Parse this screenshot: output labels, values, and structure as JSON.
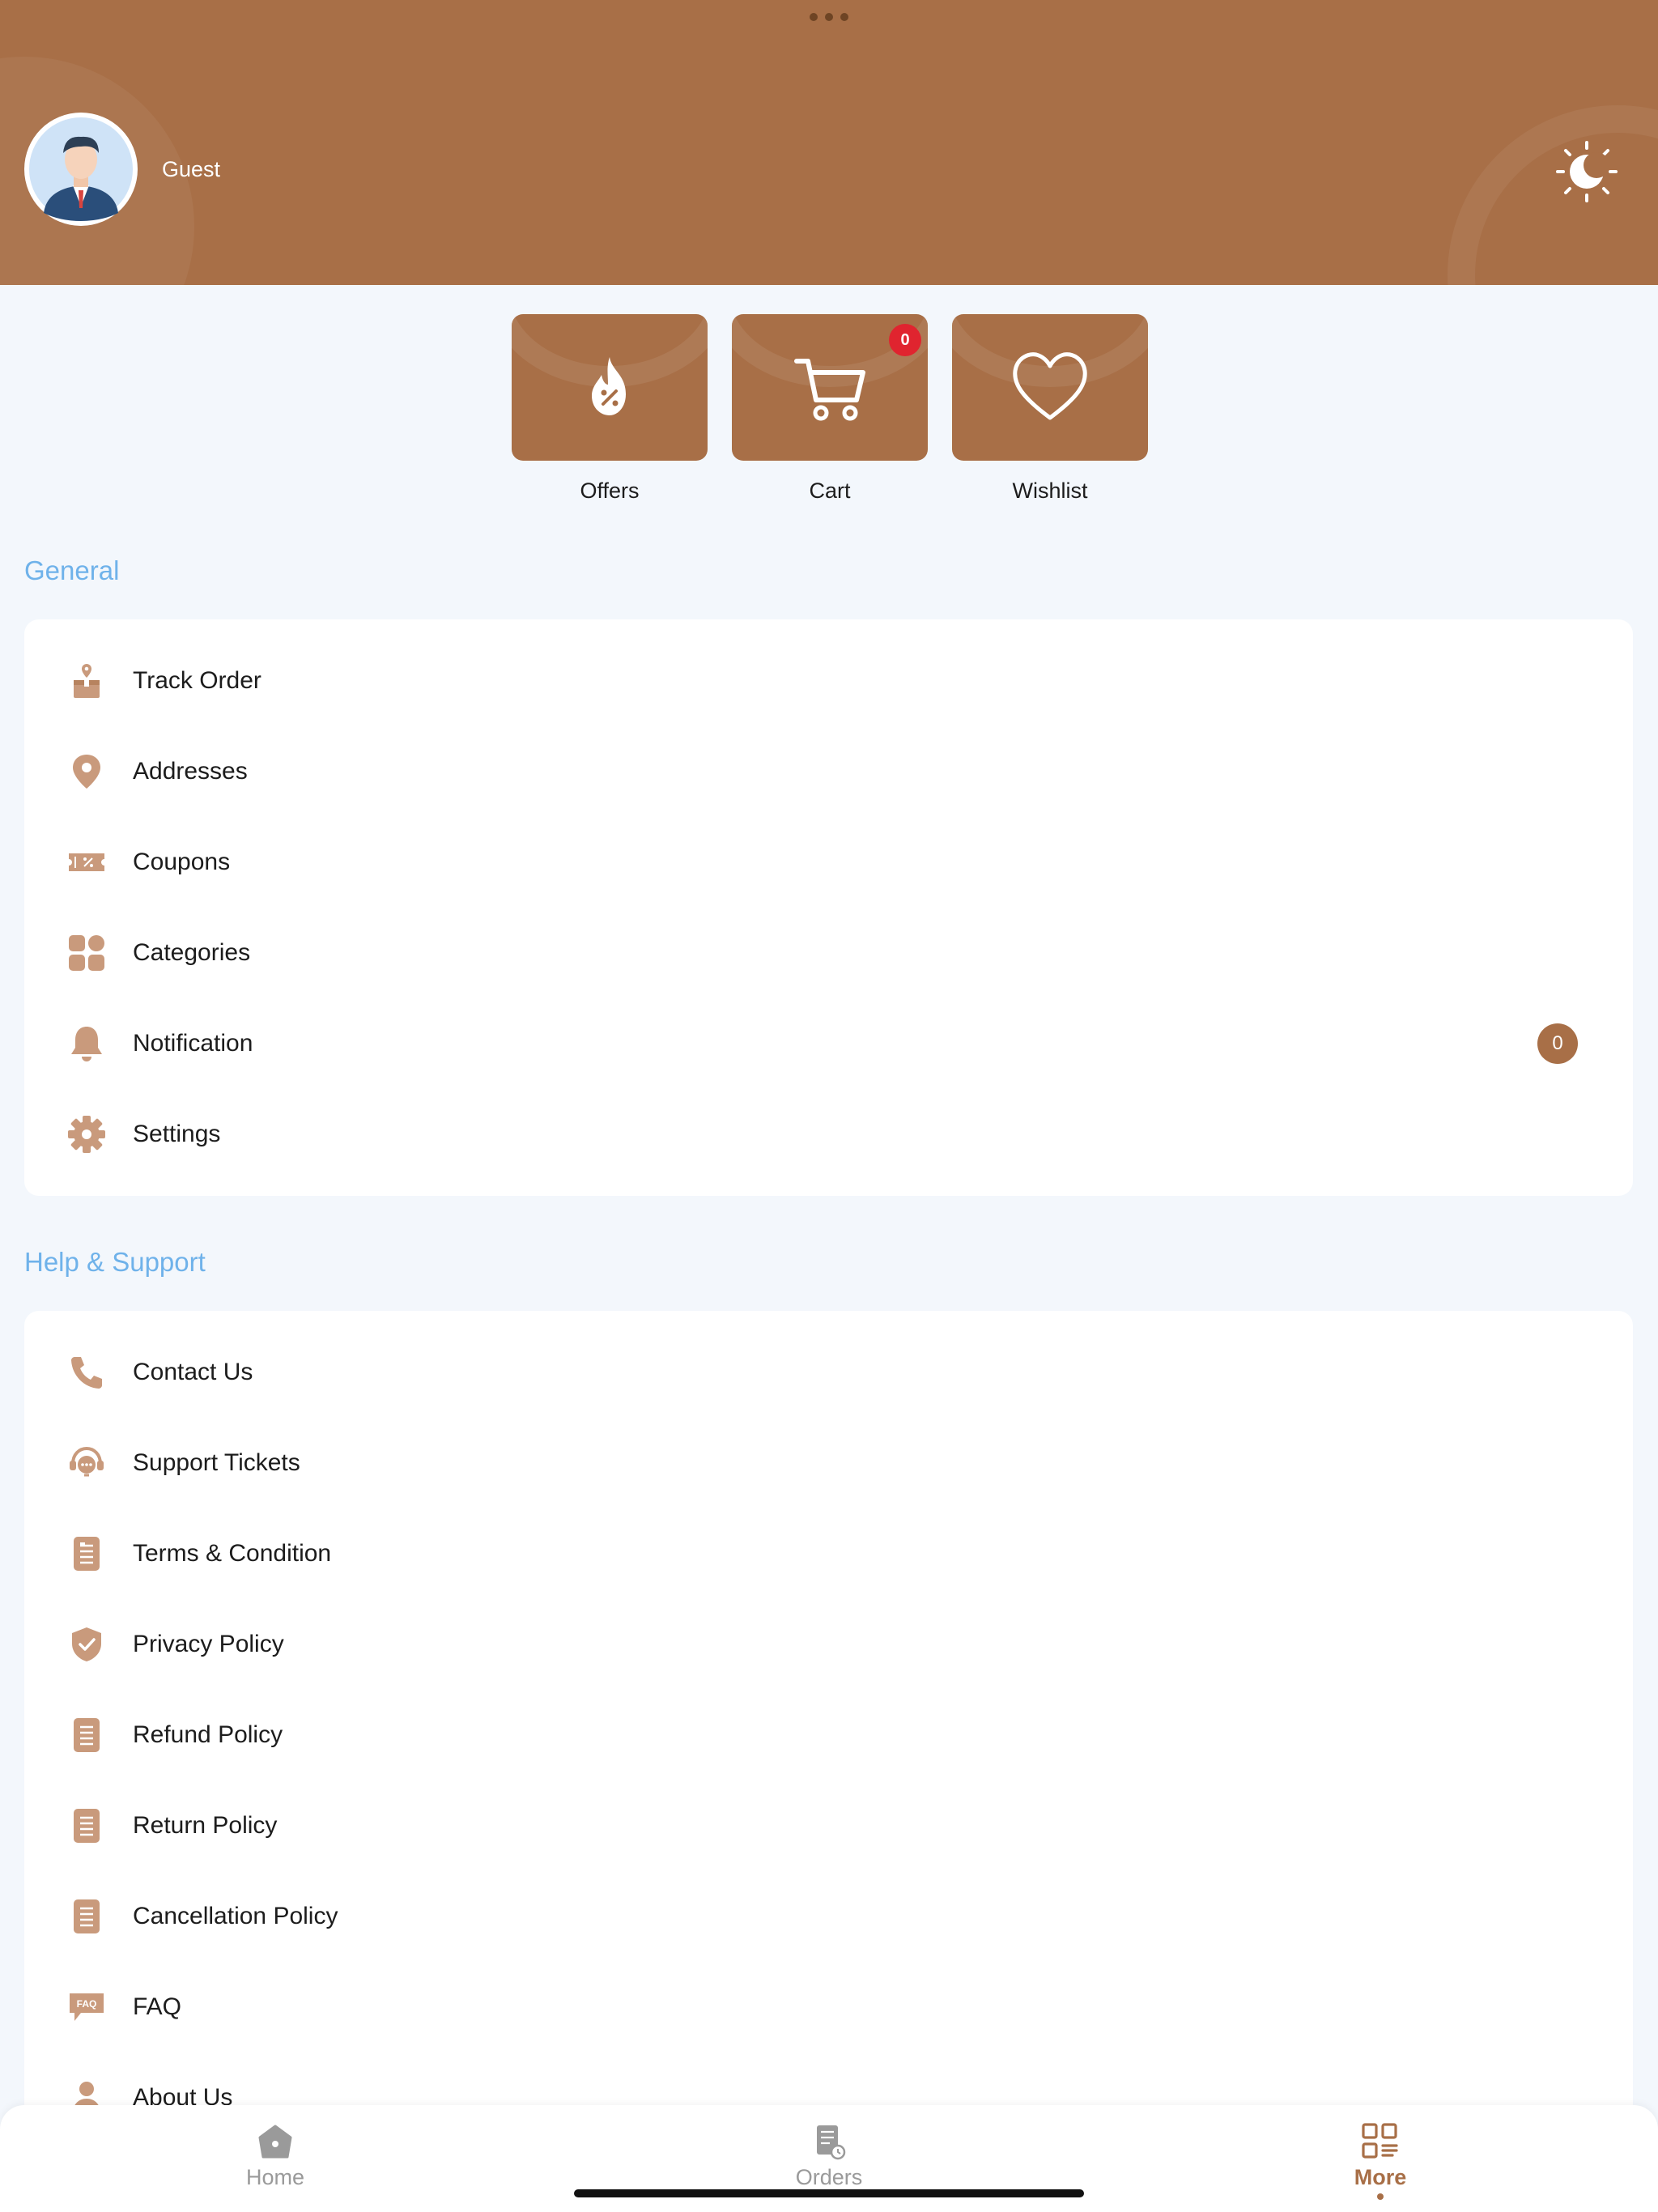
{
  "header": {
    "user_name": "Guest",
    "theme_toggle_icon": "sun-moon-icon",
    "accent_color": "#a86f47"
  },
  "quick_actions": [
    {
      "label": "Offers",
      "icon": "offer-flame-icon"
    },
    {
      "label": "Cart",
      "icon": "cart-icon",
      "badge": "0"
    },
    {
      "label": "Wishlist",
      "icon": "heart-icon"
    }
  ],
  "general": {
    "title": "General",
    "items": [
      {
        "label": "Track Order",
        "icon": "track-order-icon"
      },
      {
        "label": "Addresses",
        "icon": "location-pin-icon"
      },
      {
        "label": "Coupons",
        "icon": "coupon-icon"
      },
      {
        "label": "Categories",
        "icon": "categories-icon"
      },
      {
        "label": "Notification",
        "icon": "bell-icon",
        "count": "0"
      },
      {
        "label": "Settings",
        "icon": "gear-icon"
      }
    ]
  },
  "help": {
    "title": "Help & Support",
    "items": [
      {
        "label": "Contact Us",
        "icon": "phone-icon"
      },
      {
        "label": "Support Tickets",
        "icon": "support-headset-icon"
      },
      {
        "label": "Terms & Condition",
        "icon": "document-icon"
      },
      {
        "label": "Privacy Policy",
        "icon": "shield-check-icon"
      },
      {
        "label": "Refund Policy",
        "icon": "document-icon"
      },
      {
        "label": "Return Policy",
        "icon": "document-icon"
      },
      {
        "label": "Cancellation Policy",
        "icon": "document-icon"
      },
      {
        "label": "FAQ",
        "icon": "faq-icon"
      },
      {
        "label": "About Us",
        "icon": "person-icon"
      }
    ]
  },
  "bottom_nav": {
    "items": [
      {
        "label": "Home",
        "icon": "home-icon",
        "active": false
      },
      {
        "label": "Orders",
        "icon": "orders-icon",
        "active": false
      },
      {
        "label": "More",
        "icon": "grid-icon",
        "active": true
      }
    ]
  }
}
